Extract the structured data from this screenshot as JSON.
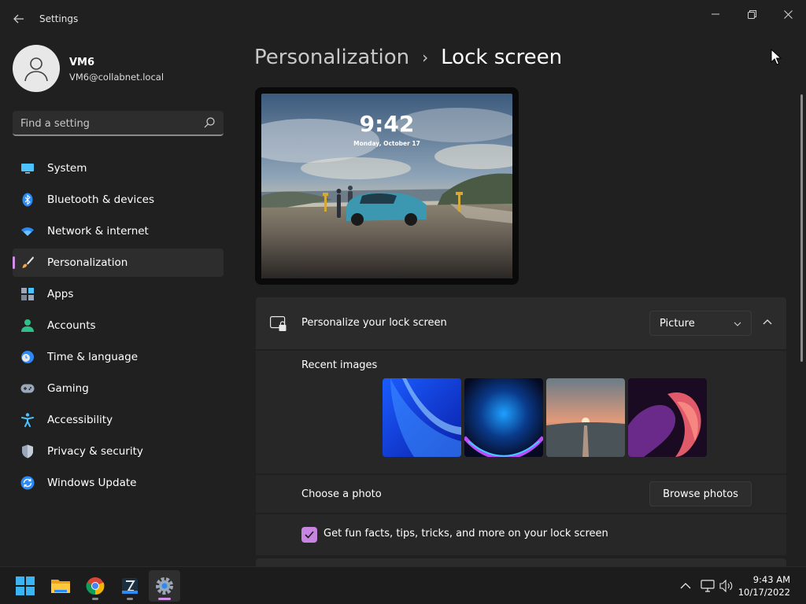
{
  "window": {
    "title": "Settings",
    "controls": {
      "minimize": "minimize-icon",
      "maximize": "restore-icon",
      "close": "close-icon"
    }
  },
  "user": {
    "name": "VM6",
    "email": "VM6@collabnet.local"
  },
  "search": {
    "placeholder": "Find a setting"
  },
  "nav": [
    {
      "label": "System",
      "icon": "monitor-icon"
    },
    {
      "label": "Bluetooth & devices",
      "icon": "bluetooth-icon"
    },
    {
      "label": "Network & internet",
      "icon": "wifi-icon"
    },
    {
      "label": "Personalization",
      "icon": "brush-icon",
      "active": true
    },
    {
      "label": "Apps",
      "icon": "apps-icon"
    },
    {
      "label": "Accounts",
      "icon": "person-icon"
    },
    {
      "label": "Time & language",
      "icon": "clock-globe-icon"
    },
    {
      "label": "Gaming",
      "icon": "gamepad-icon"
    },
    {
      "label": "Accessibility",
      "icon": "accessibility-icon"
    },
    {
      "label": "Privacy & security",
      "icon": "shield-icon"
    },
    {
      "label": "Windows Update",
      "icon": "update-icon"
    }
  ],
  "breadcrumb": {
    "parent": "Personalization",
    "separator": "›",
    "current": "Lock screen"
  },
  "preview": {
    "time": "9:42",
    "date": "Monday, October 17"
  },
  "lock_screen": {
    "title": "Personalize your lock screen",
    "selected": "Picture",
    "recent_label": "Recent images",
    "photo_label": "Choose a photo",
    "browse_label": "Browse photos",
    "facts_label": "Get fun facts, tips, tricks, and more on your lock screen",
    "facts_checked": true
  },
  "taskbar": {
    "apps": [
      "start-icon",
      "file-explorer-icon",
      "chrome-icon",
      "app-icon",
      "settings-icon"
    ],
    "clock": {
      "time": "9:43 AM",
      "date": "10/17/2022"
    }
  },
  "colors": {
    "accent": "#d18ee8",
    "checkbox": "#c784e0",
    "background": "#202020",
    "card": "#2b2b2b"
  }
}
